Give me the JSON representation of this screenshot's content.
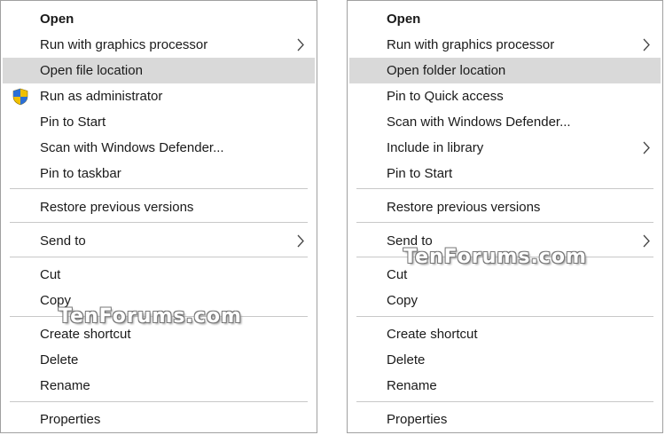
{
  "left_menu": {
    "items": [
      {
        "label": "Open"
      },
      {
        "label": "Run with graphics processor"
      },
      {
        "label": "Open file location"
      },
      {
        "label": "Run as administrator"
      },
      {
        "label": "Pin to Start"
      },
      {
        "label": "Scan with Windows Defender..."
      },
      {
        "label": "Pin to taskbar"
      },
      {
        "label": "Restore previous versions"
      },
      {
        "label": "Send to"
      },
      {
        "label": "Cut"
      },
      {
        "label": "Copy"
      },
      {
        "label": "Create shortcut"
      },
      {
        "label": "Delete"
      },
      {
        "label": "Rename"
      },
      {
        "label": "Properties"
      }
    ]
  },
  "right_menu": {
    "items": [
      {
        "label": "Open"
      },
      {
        "label": "Run with graphics processor"
      },
      {
        "label": "Open folder location"
      },
      {
        "label": "Pin to Quick access"
      },
      {
        "label": "Scan with Windows Defender..."
      },
      {
        "label": "Include in library"
      },
      {
        "label": "Pin to Start"
      },
      {
        "label": "Restore previous versions"
      },
      {
        "label": "Send to"
      },
      {
        "label": "Cut"
      },
      {
        "label": "Copy"
      },
      {
        "label": "Create shortcut"
      },
      {
        "label": "Delete"
      },
      {
        "label": "Rename"
      },
      {
        "label": "Properties"
      }
    ]
  },
  "watermark": "TenForums.com",
  "colors": {
    "highlight": "#d9d9d9",
    "separator": "#c8c8c8",
    "border": "#a0a0a0"
  },
  "icons": {
    "admin": "uac-shield-icon",
    "submenu": "chevron-right-icon"
  }
}
